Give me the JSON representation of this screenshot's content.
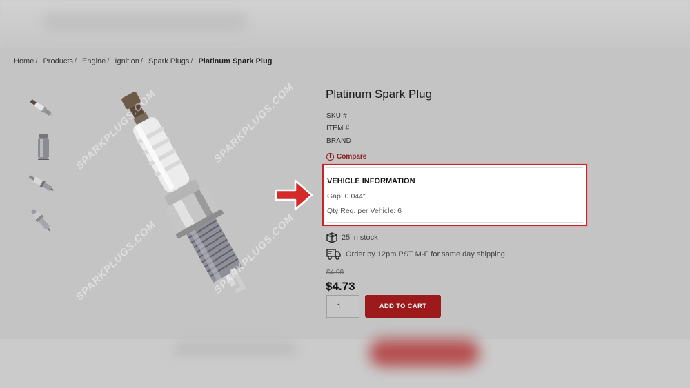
{
  "breadcrumb": {
    "items": [
      "Home",
      "Products",
      "Engine",
      "Ignition",
      "Spark Plugs"
    ],
    "separator": "/",
    "current": "Platinum Spark Plug"
  },
  "product": {
    "title": "Platinum Spark Plug",
    "sku_label": "SKU #",
    "item_label": "ITEM #",
    "brand_label": "BRAND",
    "compare_label": "Compare",
    "watermark": "SPARKPLUGS.COM"
  },
  "vehicle_info": {
    "title": "VEHICLE INFORMATION",
    "gap": "Gap: 0.044\"",
    "qty_required": "Qty Req. per Vehicle: 6"
  },
  "stock": {
    "text": "25 in stock",
    "icon": "box-icon"
  },
  "shipping": {
    "text": "Order by 12pm PST M-F for same day shipping",
    "icon": "truck-icon"
  },
  "pricing": {
    "old_price": "$4.98",
    "price": "$4.73"
  },
  "cart": {
    "quantity": "1",
    "add_label": "ADD TO CART"
  },
  "colors": {
    "accent": "#9c1a1c",
    "highlight_border": "#c0262c",
    "arrow": "#d42a2a"
  }
}
